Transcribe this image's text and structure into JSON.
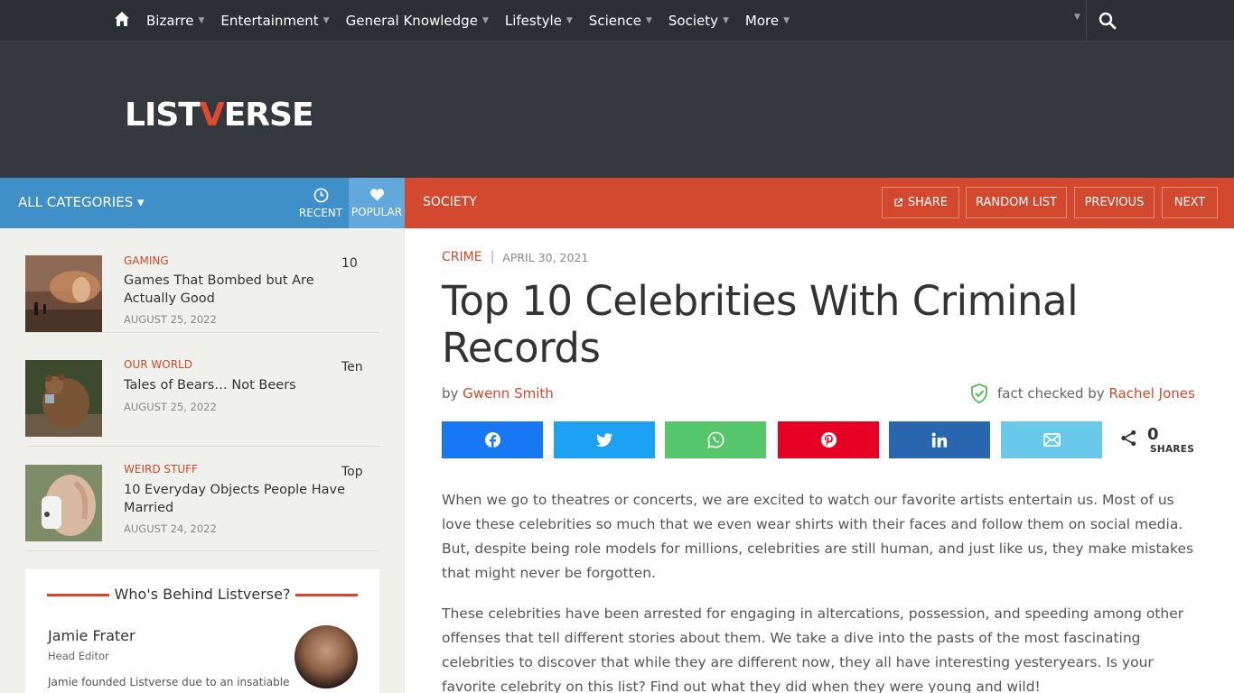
{
  "nav": {
    "items": [
      {
        "label": "Bizarre"
      },
      {
        "label": "Entertainment"
      },
      {
        "label": "General Knowledge"
      },
      {
        "label": "Lifestyle"
      },
      {
        "label": "Science"
      },
      {
        "label": "Society"
      },
      {
        "label": "More"
      }
    ]
  },
  "logo": {
    "part1": "LIST",
    "v": "V",
    "part2": "ERSE"
  },
  "catbar": {
    "all_categories": "ALL CATEGORIES ▾",
    "recent": "RECENT",
    "popular": "POPULAR"
  },
  "redbar": {
    "section": "SOCIETY",
    "share": "SHARE",
    "random": "RANDOM LIST",
    "previous": "PREVIOUS",
    "next": "NEXT"
  },
  "sidebar": {
    "posts": [
      {
        "category": "GAMING",
        "title": "Games That Bombed but Are Actually Good",
        "num": "10",
        "date": "AUGUST 25, 2022"
      },
      {
        "category": "OUR WORLD",
        "title": "Tales of Bears… Not Beers",
        "num": "Ten",
        "date": "AUGUST 25, 2022"
      },
      {
        "category": "WEIRD STUFF",
        "title": "10 Everyday Objects People Have Married",
        "num": "Top",
        "date": "AUGUST 24, 2022"
      }
    ],
    "behind": {
      "heading": "Who's Behind Listverse?",
      "name": "Jamie Frater",
      "role": "Head Editor",
      "bio": "Jamie founded Listverse due to an insatiable"
    }
  },
  "article": {
    "category": "CRIME",
    "date": "APRIL 30, 2021",
    "title": "Top 10 Celebrities With Criminal Records",
    "by": "by ",
    "author": "Gwenn Smith",
    "factcheck_label": "fact checked by ",
    "factchecker": "Rachel Jones",
    "share_count": "0",
    "share_label": "SHARES",
    "paragraphs": [
      "When we go to theatres or concerts, we are excited to watch our favorite artists entertain us. Most of us love these celebrities so much that we even wear shirts with their faces and follow them on social media.  But, despite being role models for millions, celebrities are still human, and just like us, they make mistakes that might never be forgotten.",
      "These celebrities have been arrested for engaging in altercations, possession, and speeding among other offenses that tell different stories about them. We take a dive into the pasts of the most fascinating celebrities to discover that while they are different now, they all have interesting yesteryears. Is your favorite celebrity on this list? Find out what they did when they were young and wild!"
    ]
  },
  "share_buttons": [
    {
      "icon": "facebook-icon",
      "color": "#1877f2"
    },
    {
      "icon": "twitter-icon",
      "color": "#1da1f2"
    },
    {
      "icon": "whatsapp-icon",
      "color": "#55c66a"
    },
    {
      "icon": "pinterest-icon",
      "color": "#e60023"
    },
    {
      "icon": "linkedin-icon",
      "color": "#2a66b0"
    },
    {
      "icon": "email-icon",
      "color": "#6ac9eb"
    }
  ],
  "colors": {
    "accent": "#d2492f",
    "blue": "#3f8fc9",
    "nav": "#2c2f34",
    "header": "#35383e"
  }
}
